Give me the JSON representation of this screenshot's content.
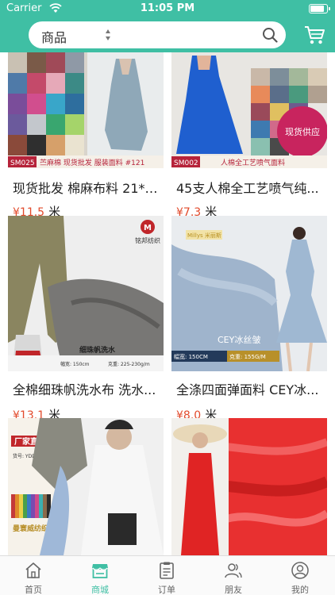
{
  "status_bar": {
    "carrier": "Carrier",
    "time": "11:05 PM"
  },
  "header": {
    "search_scope": "商品"
  },
  "products": [
    {
      "title": "现货批发 棉麻布料 21*1...",
      "currency": "¥",
      "price": "11.5",
      "unit": "米",
      "image_caption": {
        "code": "SM025",
        "text": "苎麻棉 现货批发 服装面料 #121"
      }
    },
    {
      "title": "45支人棉全工艺喷气纯...",
      "currency": "¥",
      "price": "7.3",
      "unit": "米",
      "image_caption": {
        "code": "SM002",
        "text": "人棉全工艺喷气面料",
        "badge": "现货供应"
      }
    },
    {
      "title": "全棉细珠帆洗水布 洗水...",
      "currency": "¥",
      "price": "13.1",
      "unit": "米",
      "image_caption": {
        "brand": "铭邦纺织",
        "text": "细珠帆洗水",
        "width_label": "幅宽: 150cm",
        "weight_label": "克重: 225-230g/m"
      }
    },
    {
      "title": "全涤四面弹面料 CEY冰...",
      "currency": "¥",
      "price": "8.0",
      "unit": "米",
      "image_caption": {
        "brand": "Millys 米丽斯",
        "text": "CEY冰丝皱",
        "width_label": "幅宽: 150CM",
        "weight_label": "克重: 155G/M"
      }
    },
    {
      "image_caption": {
        "brand": "厂家直销",
        "code_label": "货号: YDD611",
        "footer": "曼寰威纺织"
      }
    },
    {
      "image_caption": {}
    }
  ],
  "tabbar": {
    "items": [
      {
        "label": "首页",
        "icon": "home-icon",
        "active": false
      },
      {
        "label": "商城",
        "icon": "store-icon",
        "active": true
      },
      {
        "label": "订单",
        "icon": "order-icon",
        "active": false
      },
      {
        "label": "朋友",
        "icon": "friends-icon",
        "active": false
      },
      {
        "label": "我的",
        "icon": "profile-icon",
        "active": false
      }
    ]
  },
  "colors": {
    "accent": "#3fbfa4",
    "price": "#e24a2b"
  }
}
